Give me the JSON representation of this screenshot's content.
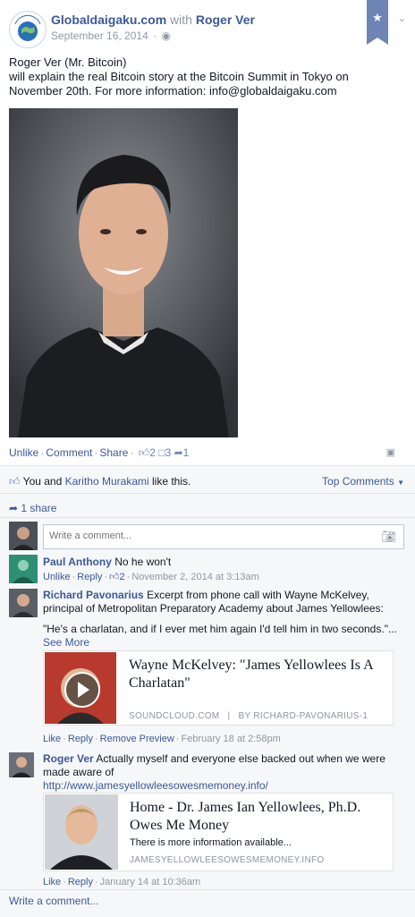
{
  "header": {
    "page_name": "Globaldaigaku.com",
    "with_text": "with",
    "with_name": "Roger Ver",
    "date": "September 16, 2014",
    "logo_text": "GLOBAL DAIGAKU"
  },
  "post": {
    "line1": "Roger Ver (Mr. Bitcoin)",
    "line2": "will explain the real Bitcoin story at the Bitcoin Summit in Tokyo on November 20th. For more information: info@globaldaigaku.com"
  },
  "actions": {
    "unlike": "Unlike",
    "comment": "Comment",
    "share": "Share",
    "like_count": "2",
    "comment_count": "3",
    "share_count": "1"
  },
  "likes": {
    "you_and": "You and",
    "liker": "Karitho Murakami",
    "like_this": "like this.",
    "top_comments": "Top Comments"
  },
  "shares": {
    "label": "1 share"
  },
  "composer": {
    "placeholder": "Write a comment..."
  },
  "comments": [
    {
      "name": "Paul Anthony",
      "text": "No he won't",
      "unlike": "Unlike",
      "reply": "Reply",
      "likes": "2",
      "time": "November 2, 2014 at 3:13am"
    },
    {
      "name": "Richard Pavonarius",
      "text": "Excerpt from phone call with Wayne McKelvey, principal of Metropolitan Preparatory Academy about James Yellowlees:",
      "quote": "\"He's a charlatan, and if I ever met him again I'd tell him in two seconds.\"...",
      "see_more": "See More",
      "card_title": "Wayne McKelvey: \"James Yellowlees Is A Charlatan\"",
      "card_domain": "SOUNDCLOUD.COM",
      "card_by": "BY RICHARD-PAVONARIUS-1",
      "like": "Like",
      "reply": "Reply",
      "remove_preview": "Remove Preview",
      "time": "February 18 at 2:58pm"
    },
    {
      "name": "Roger Ver",
      "text": "Actually myself and everyone else backed out when we were made aware of",
      "url": "http://www.jamesyellowleesowesmemoney.info/",
      "card_title": "Home - Dr. James Ian Yellowlees, Ph.D. Owes Me Money",
      "card_desc": "There is more information available...",
      "card_domain": "JAMESYELLOWLEESOWESMEMONEY.INFO",
      "like": "Like",
      "reply": "Reply",
      "time": "January 14 at 10:36am"
    }
  ],
  "write_comment": "Write a comment...",
  "colors": {
    "link": "#3b5998",
    "muted": "#9197a3",
    "bookmark": "#6d84b4",
    "soundcloud_bg": "#b83a2e"
  }
}
